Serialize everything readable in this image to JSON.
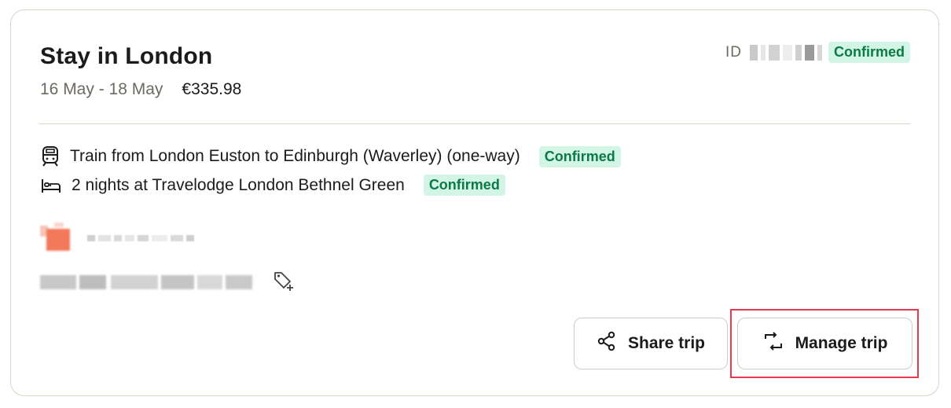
{
  "trip": {
    "title": "Stay in London",
    "dates": "16 May - 18 May",
    "price": "€335.98",
    "id_label": "ID",
    "status": "Confirmed"
  },
  "items": [
    {
      "icon": "train-icon",
      "text": "Train from London Euston to Edinburgh (Waverley) (one-way)",
      "status": "Confirmed"
    },
    {
      "icon": "bed-icon",
      "text": "2 nights at Travelodge London Bethnel Green",
      "status": "Confirmed"
    }
  ],
  "actions": {
    "share_label": "Share trip",
    "manage_label": "Manage trip"
  },
  "colors": {
    "badge_bg": "#d3f5e5",
    "badge_text": "#0a7a47",
    "highlight": "#e8384f",
    "border": "#d9d6c8"
  }
}
